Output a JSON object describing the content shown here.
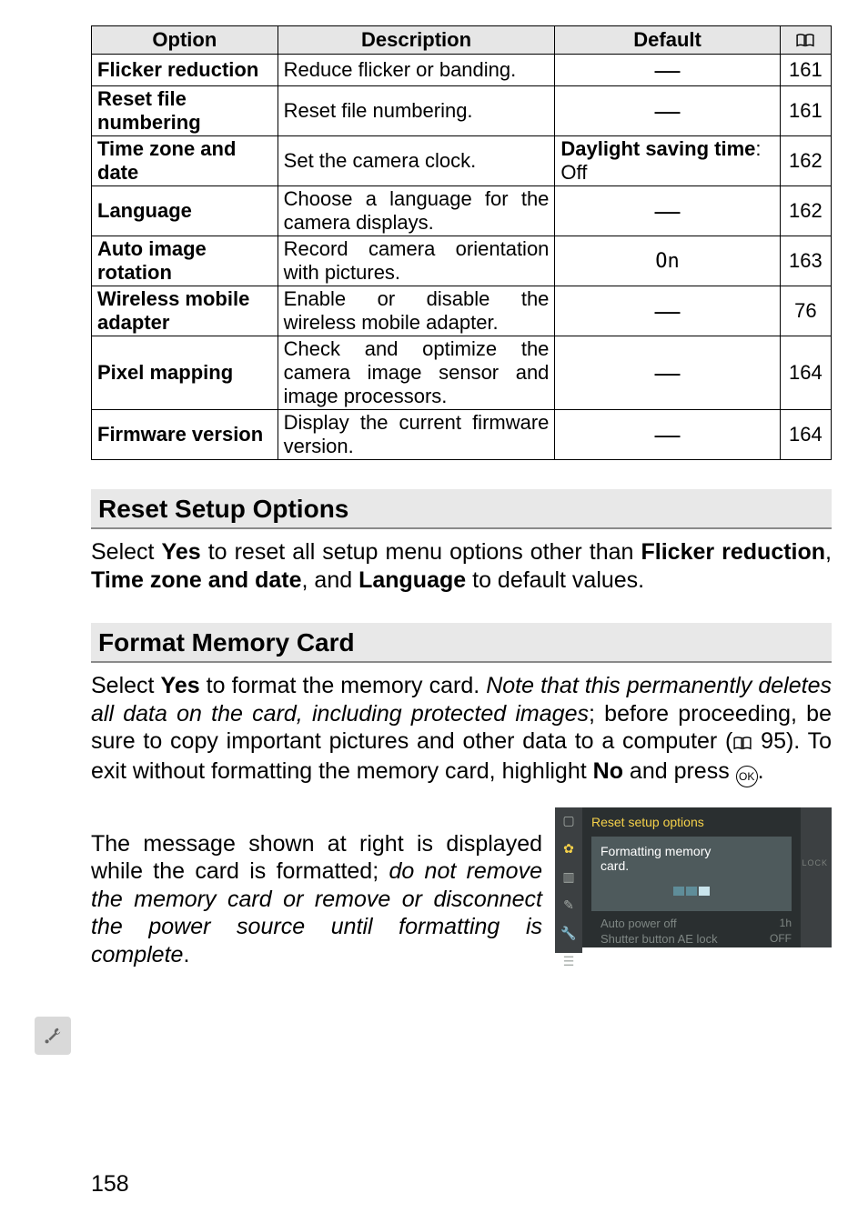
{
  "table": {
    "headers": {
      "option": "Option",
      "description": "Description",
      "default": "Default",
      "page_icon_alt": "page"
    },
    "rows": [
      {
        "option": "Flicker reduction",
        "description": "Reduce flicker or banding.",
        "default": "—",
        "page": "161"
      },
      {
        "option": "Reset file numbering",
        "description": "Reset file numbering.",
        "default": "—",
        "page": "161"
      },
      {
        "option": "Time zone and date",
        "description": "Set the camera clock.",
        "default_bold": "Daylight saving time",
        "default_rest": ": Off",
        "page": "162"
      },
      {
        "option": "Language",
        "description": "Choose a language for the camera displays.",
        "default": "—",
        "page": "162"
      },
      {
        "option": "Auto image rotation",
        "description": "Record camera orientation with pictures.",
        "default": "On",
        "page": "163"
      },
      {
        "option": "Wireless mobile adapter",
        "description": "Enable or disable the wireless mobile adapter.",
        "default": "—",
        "page": "76"
      },
      {
        "option": "Pixel mapping",
        "description": "Check and optimize the camera image sensor and image processors.",
        "default": "—",
        "page": "164"
      },
      {
        "option": "Firmware version",
        "description": "Display the current firmware version.",
        "default": "—",
        "page": "164"
      }
    ]
  },
  "sections": {
    "reset": {
      "heading": "Reset Setup Options",
      "p1a": "Select ",
      "p1_yes": "Yes",
      "p1b": " to reset all setup menu options other than ",
      "p1_flicker": "Flicker reduction",
      "p1c": ", ",
      "p1_tz": "Time zone and date",
      "p1d": ", and ",
      "p1_lang": "Language",
      "p1e": " to default values."
    },
    "format": {
      "heading": "Format Memory Card",
      "p1a": "Select ",
      "p1_yes": "Yes",
      "p1b": " to format the memory card. ",
      "p1_note": "Note that this permanently deletes all data on the card, including protected images",
      "p1c": "; before proceeding, be sure to copy important pictures and other data to a computer (",
      "p1_ref": " 95). To exit without formatting the memory card, highlight ",
      "p1_no": "No",
      "p1d": " and press ",
      "p1e": ".",
      "p2a": "The message shown at right is displayed while the card is formatted; ",
      "p2_warn": "do not remove the memory card or remove or disconnect the power source until formatting is complete",
      "p2b": "."
    }
  },
  "screenshot": {
    "title": "Reset setup options",
    "msg1": "Formatting memory",
    "msg2": "card.",
    "lock": "LOCK",
    "dim1": "Auto power off",
    "dim1v": "1h",
    "dim2": "Shutter button AE lock",
    "dim2v": "OFF"
  },
  "page_number": "158"
}
